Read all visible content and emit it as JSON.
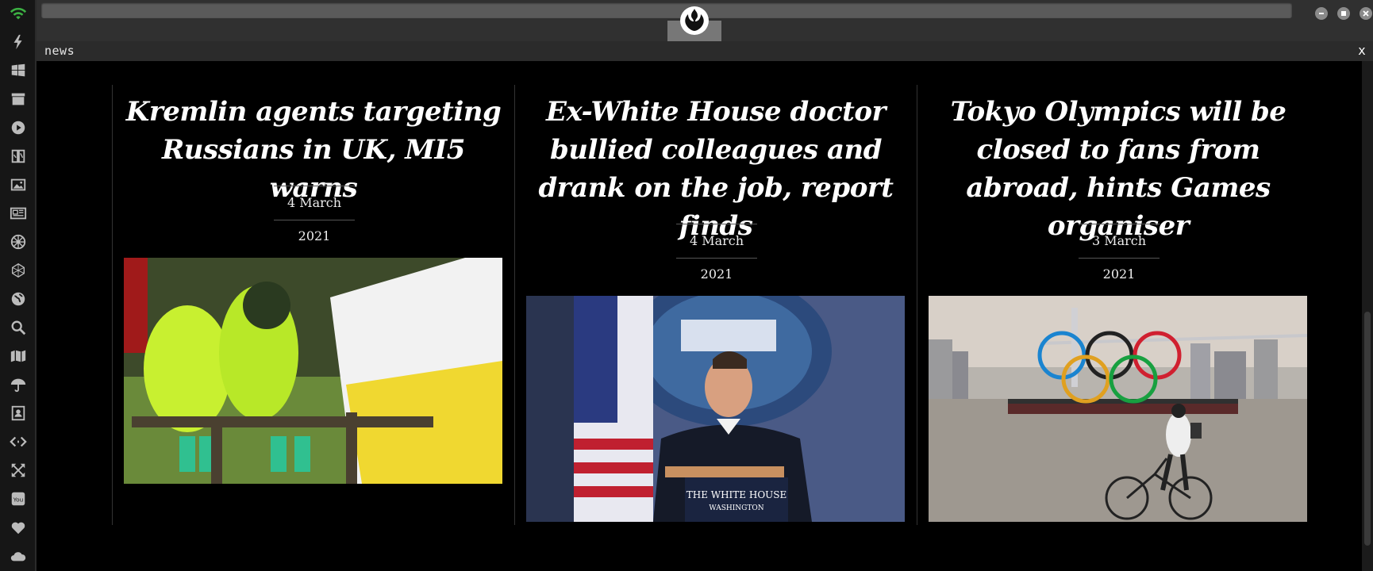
{
  "window": {
    "title": "news",
    "close_label": "x"
  },
  "sidebar": {
    "items": [
      {
        "icon": "wifi-icon"
      },
      {
        "icon": "bolt-icon"
      },
      {
        "icon": "windows-icon"
      },
      {
        "icon": "archive-icon"
      },
      {
        "icon": "play-icon"
      },
      {
        "icon": "map-book-icon"
      },
      {
        "icon": "image-icon"
      },
      {
        "icon": "newspaper-icon"
      },
      {
        "icon": "empire-icon"
      },
      {
        "icon": "network-icon"
      },
      {
        "icon": "globe-icon"
      },
      {
        "icon": "search-icon"
      },
      {
        "icon": "map-icon"
      },
      {
        "icon": "umbrella-icon"
      },
      {
        "icon": "contacts-icon"
      },
      {
        "icon": "code-icon"
      },
      {
        "icon": "expand-icon"
      },
      {
        "icon": "youtube-icon"
      },
      {
        "icon": "heart-icon"
      },
      {
        "icon": "cloud-icon"
      }
    ]
  },
  "articles": [
    {
      "title": "Kremlin agents targeting Russians in UK, MI5 warns",
      "date": "4 March 2021",
      "image": "hazmat-suits-photo"
    },
    {
      "title": "Ex-White House doctor bullied colleagues and drank on the job, report finds",
      "date": "4 March 2021",
      "image": "white-house-podium-photo"
    },
    {
      "title": "Tokyo Olympics will be closed to fans from abroad, hints Games organiser",
      "date": "3 March 2021",
      "image": "olympic-rings-photo"
    }
  ],
  "colors": {
    "background": "#000000",
    "sidebar": "#161616",
    "topbar": "#303030",
    "wifi_green": "#3cb043"
  }
}
